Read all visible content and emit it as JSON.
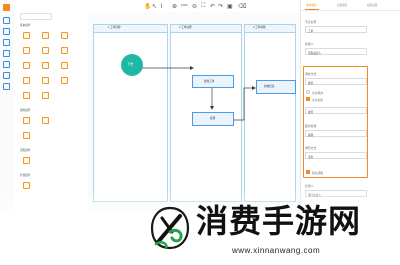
{
  "toolbar": {
    "zoom": "100%"
  },
  "sidebar": {
    "section_basic": "基本组件",
    "section_2": "通用组件",
    "section_3": "流程组件",
    "section_4": "扩展组件",
    "items_row_labels": [
      "表单",
      "流程",
      "审批",
      "通知",
      "数据"
    ]
  },
  "canvas": {
    "lane1_title": "1 工单创建",
    "lane2_title": "2 工单处理",
    "lane3_title": "3 工单验收",
    "start_label": "开始",
    "node1_label": "提交工单",
    "node2_label": "处理",
    "node3_label": "验收结束"
  },
  "panel": {
    "tabs": [
      "基本属性",
      "高级属性",
      "权限设置"
    ],
    "label1": "节点名称",
    "value1": "工单",
    "label2": "处理人",
    "value2": "流程发起人",
    "label3": "审批方式",
    "value3": "或签",
    "checkbox1": "允许转办",
    "checkbox2": "允许加签",
    "label4": "超时处理",
    "value4": "提醒",
    "label5": "通知方式",
    "value5": "消息",
    "checkbox3": "短信通知",
    "label6": "抄送人",
    "value6": "部门负责人"
  },
  "watermark": {
    "text": "消费手游网",
    "url": "www.xinnanwang.com"
  },
  "colors": {
    "accent": "#f5891f",
    "teal": "#1fb8a4",
    "lane_border": "#a9d3ef"
  }
}
